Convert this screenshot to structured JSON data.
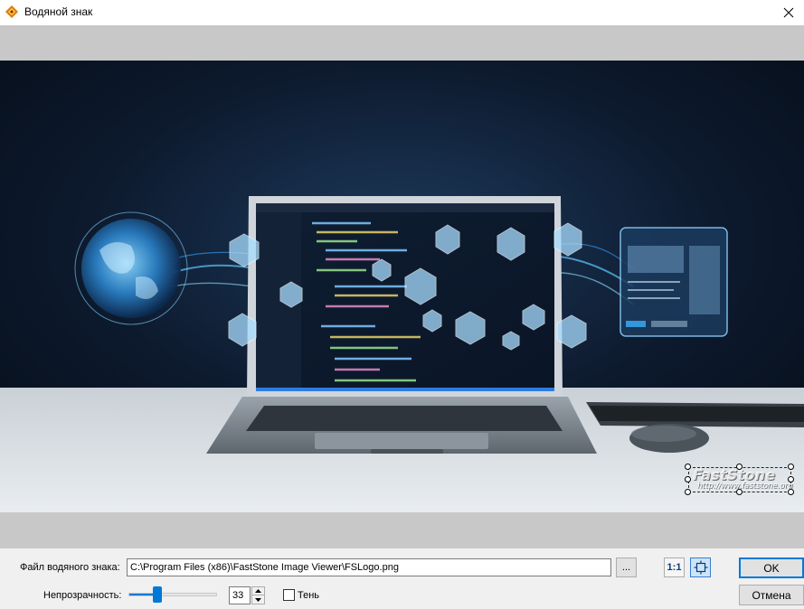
{
  "window": {
    "title": "Водяной знак",
    "icon": "faststone-app-icon",
    "close_icon": "close-icon"
  },
  "preview": {
    "image_description_icon": "laptop-code-photo",
    "watermark": {
      "logo_text": "FastStone",
      "url_text": "http://www.faststone.org"
    }
  },
  "controls": {
    "file_label": "Файл водяного знака:",
    "file_path": "C:\\Program Files (x86)\\FastStone Image Viewer\\FSLogo.png",
    "browse_label": "...",
    "actual_size_label": "1:1",
    "fit_icon": "move-fit-icon",
    "opacity_label": "Непрозрачность:",
    "opacity_value": "33",
    "opacity_fraction": 0.33,
    "shadow_label": "Тень",
    "shadow_checked": false,
    "ok_label": "OK",
    "cancel_label": "Отмена"
  },
  "colors": {
    "accent": "#0078d7",
    "preview_bg": "#c8c8c8",
    "dialog_bg": "#f0f0f0"
  }
}
